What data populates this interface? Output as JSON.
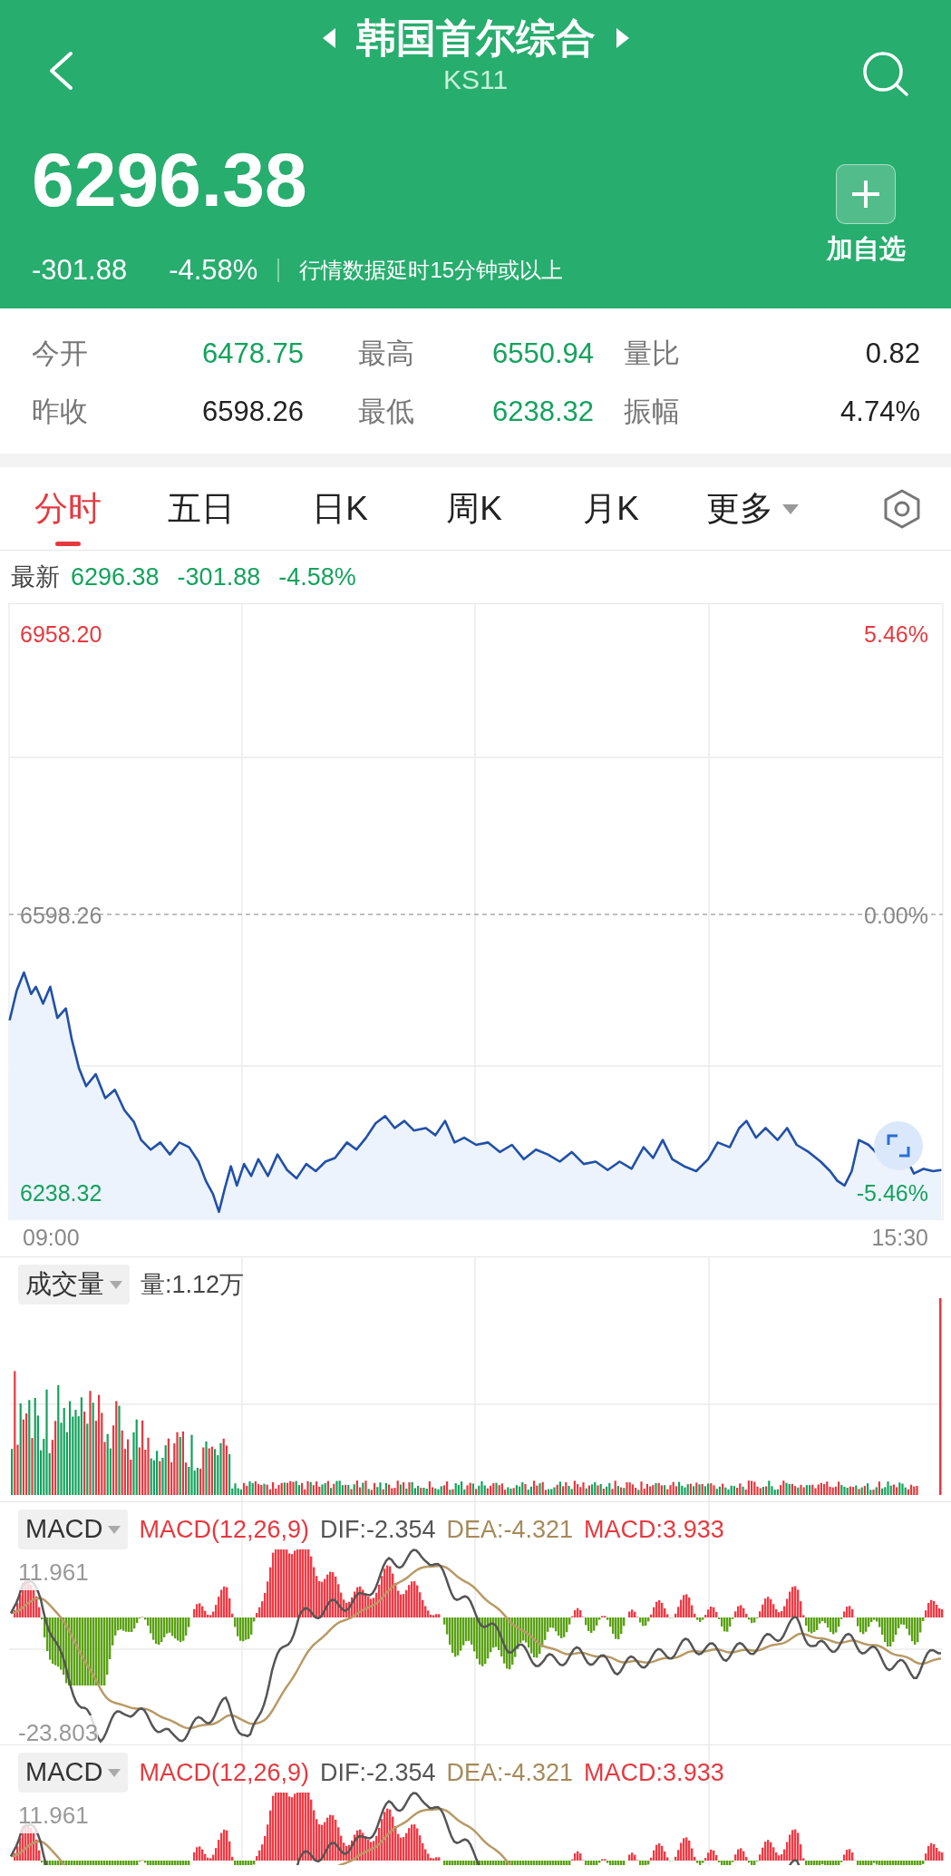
{
  "header": {
    "title": "韩国首尔综合",
    "code": "KS11",
    "price": "6296.38",
    "change": "-301.88",
    "change_pct": "-4.58%",
    "notice": "行情数据延时15分钟或以上",
    "watch_button": "加自选"
  },
  "stats": [
    [
      {
        "label": "今开",
        "value": "6478.75",
        "color": "#14a25d"
      },
      {
        "label": "最高",
        "value": "6550.94",
        "color": "#14a25d"
      },
      {
        "label": "量比",
        "value": "0.82",
        "color": "#222222"
      }
    ],
    [
      {
        "label": "昨收",
        "value": "6598.26",
        "color": "#222222"
      },
      {
        "label": "最低",
        "value": "6238.32",
        "color": "#14a25d"
      },
      {
        "label": "振幅",
        "value": "4.74%",
        "color": "#222222"
      }
    ]
  ],
  "tabs": [
    {
      "label": "分时",
      "selected": true,
      "kind": "plain"
    },
    {
      "label": "五日",
      "selected": false,
      "kind": "plain"
    },
    {
      "label": "日K",
      "selected": false,
      "kind": "plain"
    },
    {
      "label": "周K",
      "selected": false,
      "kind": "plain"
    },
    {
      "label": "月K",
      "selected": false,
      "kind": "plain"
    },
    {
      "label": "更多",
      "selected": false,
      "kind": "dropdown"
    }
  ],
  "latest": {
    "label": "最新",
    "price": "6296.38",
    "change": "-301.88",
    "change_pct": "-4.58%"
  },
  "chart": {
    "high": "6958.20",
    "high_pct": "5.46%",
    "prev_close": "6598.26",
    "prev_pct": "0.00%",
    "low": "6238.32",
    "low_pct": "-5.46%",
    "start_time": "09:00",
    "end_time": "15:30"
  },
  "volume": {
    "selector": "成交量",
    "reading": "量:1.12万"
  },
  "macd_panels": [
    {
      "selector": "MACD",
      "params": "MACD(12,26,9)",
      "dif": "DIF:-2.354",
      "dea": "DEA:-4.321",
      "macd": "MACD:3.933",
      "max": "11.961",
      "min": "-23.803"
    },
    {
      "selector": "MACD",
      "params": "MACD(12,26,9)",
      "dif": "DIF:-2.354",
      "dea": "DEA:-4.321",
      "macd": "MACD:3.933",
      "max": "11.961"
    }
  ]
}
